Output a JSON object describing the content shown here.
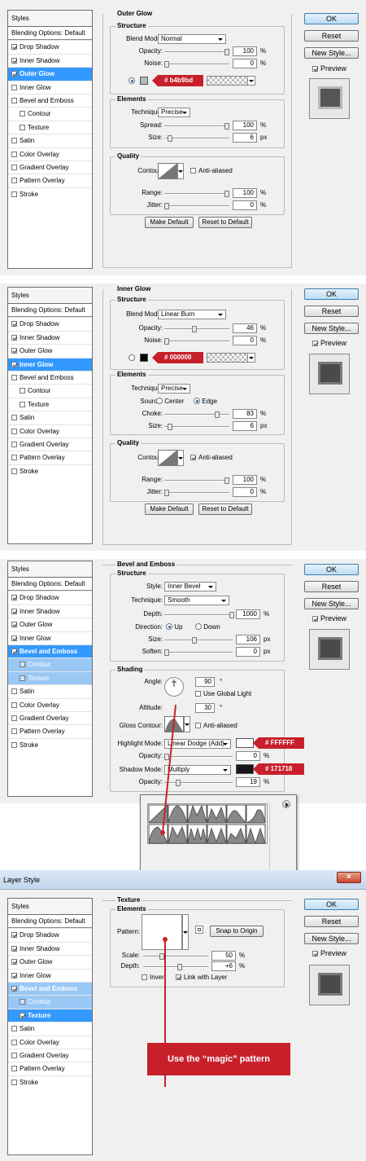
{
  "sidebar": {
    "header": "Styles",
    "blending": "Blending Options: Default",
    "items": [
      "Drop Shadow",
      "Inner Shadow",
      "Outer Glow",
      "Inner Glow",
      "Bevel and Emboss",
      "Contour",
      "Texture",
      "Satin",
      "Color Overlay",
      "Gradient Overlay",
      "Pattern Overlay",
      "Stroke"
    ]
  },
  "buttons": {
    "ok": "OK",
    "reset": "Reset",
    "new_style": "New Style...",
    "preview": "Preview",
    "make_default": "Make Default",
    "reset_default": "Reset to Default"
  },
  "common": {
    "structure": "Structure",
    "elements": "Elements",
    "quality": "Quality",
    "blend_mode": "Blend Mode:",
    "opacity": "Opacity:",
    "noise": "Noise:",
    "technique": "Technique:",
    "spread": "Spread:",
    "size": "Size:",
    "contour": "Contour:",
    "anti_aliased": "Anti-aliased",
    "range": "Range:",
    "jitter": "Jitter:",
    "pct": "%",
    "px": "px",
    "source": "Source:",
    "center": "Center",
    "edge": "Edge",
    "choke": "Choke:"
  },
  "outer_glow": {
    "title": "Outer Glow",
    "blend_mode": "Normal",
    "opacity": "100",
    "noise": "0",
    "color_tag": "# b4b9bd",
    "color": "#b4b9bd",
    "technique": "Precise",
    "spread": "100",
    "size": "6",
    "range": "100",
    "jitter": "0"
  },
  "inner_glow": {
    "title": "Inner Glow",
    "blend_mode": "Linear Burn",
    "opacity": "46",
    "noise": "0",
    "color_tag": "# 000000",
    "color": "#000000",
    "technique": "Precise",
    "choke": "83",
    "size": "6",
    "range": "100",
    "jitter": "0"
  },
  "bevel": {
    "title": "Bevel and Emboss",
    "structure": "Structure",
    "style_label": "Style:",
    "style": "Inner Bevel",
    "technique": "Smooth",
    "depth_label": "Depth:",
    "depth": "1000",
    "direction_label": "Direction:",
    "up": "Up",
    "down": "Down",
    "size": "106",
    "soften_label": "Soften:",
    "soften": "0",
    "shading": "Shading",
    "angle_label": "Angle:",
    "angle": "90",
    "deg": "°",
    "global_light": "Use Global Light",
    "altitude_label": "Altitude:",
    "altitude": "30",
    "gloss_label": "Gloss Contour:",
    "highlight_label": "Highlight Mode:",
    "highlight_mode": "Linear Dodge (Add)",
    "highlight_color": "#FFFFFF",
    "highlight_tag": "# FFFFFF",
    "highlight_opacity": "0",
    "shadow_label": "Shadow Mode:",
    "shadow_mode": "Multiply",
    "shadow_color": "#171718",
    "shadow_tag": "# 171718",
    "shadow_opacity": "19"
  },
  "texture": {
    "window_title": "Layer Style",
    "title": "Texture",
    "elements": "Elements",
    "pattern_label": "Pattern:",
    "snap": "Snap to Origin",
    "scale_label": "Scale:",
    "scale": "50",
    "depth_label": "Depth:",
    "depth": "+6",
    "invert": "Invert",
    "link": "Link with Layer",
    "callout": "Use the “magic” pattern"
  }
}
